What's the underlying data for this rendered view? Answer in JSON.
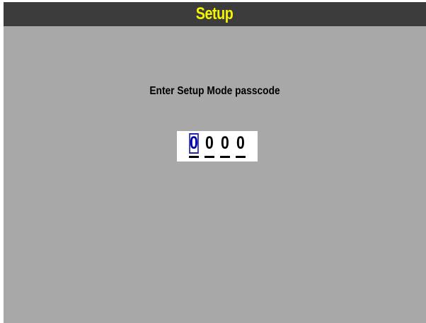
{
  "header": {
    "title": "Setup"
  },
  "main": {
    "prompt": "Enter Setup Mode passcode",
    "passcode": {
      "digits": [
        "0",
        "0",
        "0",
        "0"
      ],
      "selected_index": 0
    }
  },
  "colors": {
    "background": "#a8a8a8",
    "titlebar": "#3c3c3c",
    "title_text": "#f5f500",
    "selected_digit": "#0000aa"
  }
}
